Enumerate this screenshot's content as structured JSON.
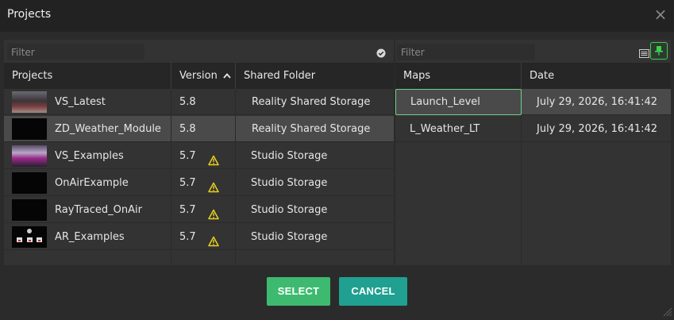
{
  "window": {
    "title": "Projects",
    "close_icon": "×"
  },
  "projects": {
    "filter_placeholder": "Filter",
    "headers": {
      "projects": "Projects",
      "version": "Version",
      "sort_arrow": "^",
      "shared_folder": "Shared Folder"
    },
    "rows": [
      {
        "name": "VS_Latest",
        "version": "5.8",
        "folder": "Reality Shared Storage",
        "warning": false,
        "selected": false,
        "thumb": "studio"
      },
      {
        "name": "ZD_Weather_Module",
        "version": "5.8",
        "folder": "Reality Shared Storage",
        "warning": false,
        "selected": true,
        "thumb": "black"
      },
      {
        "name": "VS_Examples",
        "version": "5.7",
        "folder": "Studio Storage",
        "warning": true,
        "selected": false,
        "thumb": "purple"
      },
      {
        "name": "OnAirExample",
        "version": "5.7",
        "folder": "Studio Storage",
        "warning": true,
        "selected": false,
        "thumb": "black"
      },
      {
        "name": "RayTraced_OnAir",
        "version": "5.7",
        "folder": "Studio Storage",
        "warning": true,
        "selected": false,
        "thumb": "black"
      },
      {
        "name": "AR_Examples",
        "version": "5.7",
        "folder": "Studio Storage",
        "warning": true,
        "selected": false,
        "thumb": "ar"
      }
    ]
  },
  "maps": {
    "filter_placeholder": "Filter",
    "headers": {
      "maps": "Maps",
      "date": "Date"
    },
    "rows": [
      {
        "name": "Launch_Level",
        "date": "July 29, 2026, 16:41:42",
        "selected": true
      },
      {
        "name": "L_Weather_LT",
        "date": "July 29, 2026, 16:41:42",
        "selected": false
      }
    ]
  },
  "buttons": {
    "select": "SELECT",
    "cancel": "CANCEL"
  },
  "colors": {
    "select": "#3dba6f",
    "cancel": "#20a090",
    "warning": "#e8d21d",
    "pin": "#3ccf4e",
    "selection_border": "#6fd08a"
  }
}
